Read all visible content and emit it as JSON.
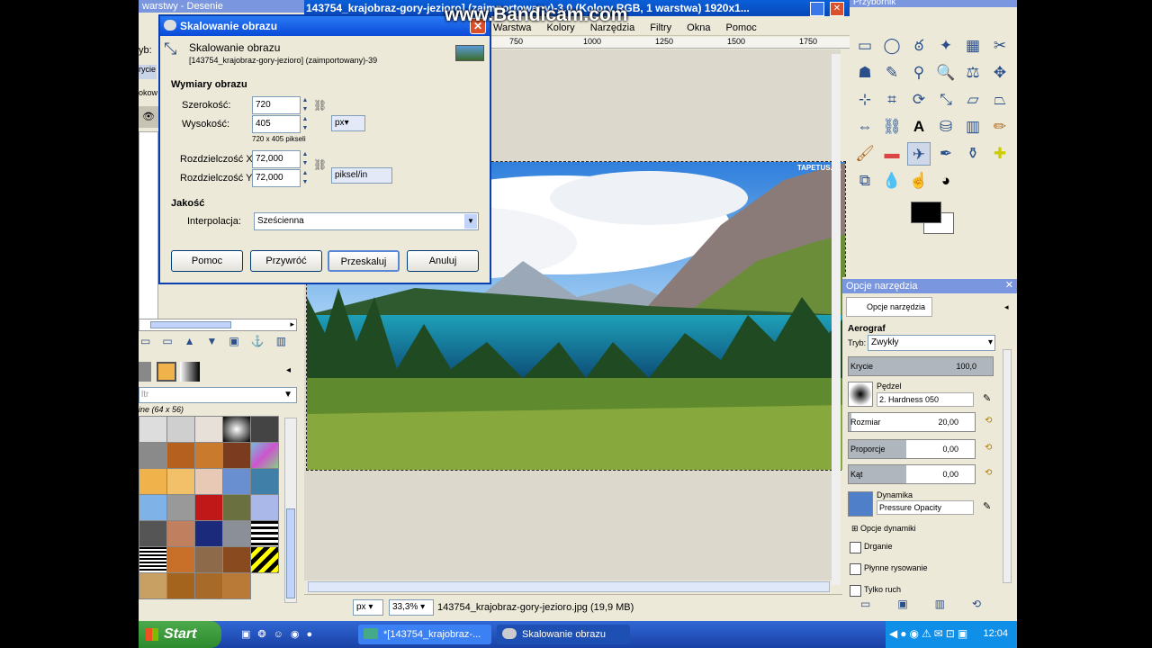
{
  "recorder_watermark": "www.Bandicam.com",
  "left_panel": {
    "top_title": "warstwy - Desenie",
    "side_labels": [
      "yb:",
      "rycie",
      "okow"
    ],
    "pattern_filter_placeholder": "ltr",
    "pattern_size": "ine (64 x 56)"
  },
  "image_window": {
    "title": "143754_krajobraz-gory-jezioro] (zaimportowany)-3.0 (Kolory RGB, 1 warstwa) 1920x1...",
    "menu": [
      "Warstwa",
      "Kolory",
      "Narzędzia",
      "Filtry",
      "Okna",
      "Pomoc"
    ],
    "ruler_ticks": [
      "750",
      "1000",
      "1250",
      "1500",
      "1750"
    ],
    "photo_watermark": "TAPETUS.PL",
    "status": {
      "unit": "px",
      "zoom": "33,3%",
      "filename": "143754_krajobraz-gory-jezioro.jpg (19,9 MB)"
    }
  },
  "toolbox": {
    "title": "Przybornik"
  },
  "tool_options": {
    "title": "Opcje narzędzia",
    "tab": "Opcje narzędzia",
    "tool_name": "Aerograf",
    "mode_label": "Tryb:",
    "mode_value": "Zwykły",
    "opacity_label": "Krycie",
    "opacity_value": "100,0",
    "brush_label": "Pędzel",
    "brush_value": "2. Hardness 050",
    "size_label": "Rozmiar",
    "size_value": "20,00",
    "aspect_label": "Proporcje",
    "aspect_value": "0,00",
    "angle_label": "Kąt",
    "angle_value": "0,00",
    "dynamics_label": "Dynamika",
    "dynamics_value": "Pressure Opacity",
    "dynamics_options": "Opcje dynamiki",
    "jitter": "Drganie",
    "smooth": "Płynne rysowanie",
    "motion_only": "Tylko ruch"
  },
  "dialog": {
    "title": "Skalowanie obrazu",
    "heading": "Skalowanie obrazu",
    "subheading": "[143754_krajobraz-gory-jezioro] (zaimportowany)-39",
    "section_size": "Wymiary obrazu",
    "width_label": "Szerokość:",
    "width_value": "720",
    "height_label": "Wysokość:",
    "height_value": "405",
    "pixel_summary": "720 x 405 pikseli",
    "size_unit": "px",
    "resx_label": "Rozdzielczość X:",
    "resx_value": "72,000",
    "resy_label": "Rozdzielczość Y:",
    "resy_value": "72,000",
    "res_unit": "piksel/in",
    "section_quality": "Jakość",
    "interp_label": "Interpolacja:",
    "interp_value": "Sześcienna",
    "btn_help": "Pomoc",
    "btn_reset": "Przywróć",
    "btn_scale": "Przeskaluj",
    "btn_cancel": "Anuluj"
  },
  "taskbar": {
    "start": "Start",
    "task1": "*[143754_krajobraz-...",
    "task2": "Skalowanie obrazu",
    "clock": "12:04"
  },
  "colors": {
    "xp_blue": "#0a4ad8",
    "fg_color": "#000000",
    "bg_color": "#ffffff"
  }
}
